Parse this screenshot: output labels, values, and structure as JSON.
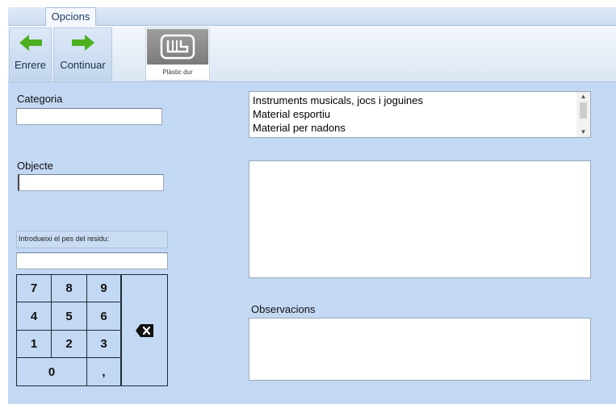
{
  "ribbon": {
    "tab_label": "Opcions",
    "back_label": "Enrere",
    "next_label": "Continuar",
    "material_label": "Plàstic dur",
    "accent_green": "#4caf1e"
  },
  "form": {
    "category_label": "Categoria",
    "category_value": "",
    "object_label": "Objecte",
    "object_value": "",
    "weight_prompt": "Introdueixi el pes del residu:",
    "weight_value": "",
    "observations_label": "Observacions",
    "observations_value": ""
  },
  "keypad": {
    "keys": [
      "7",
      "8",
      "9",
      "4",
      "5",
      "6",
      "1",
      "2",
      "3",
      "0",
      ","
    ],
    "backspace_icon": "backspace-icon"
  },
  "category_list": {
    "items": [
      "Instruments musicals, jocs i joguines",
      "Material esportiu",
      "Material per nadons"
    ]
  }
}
